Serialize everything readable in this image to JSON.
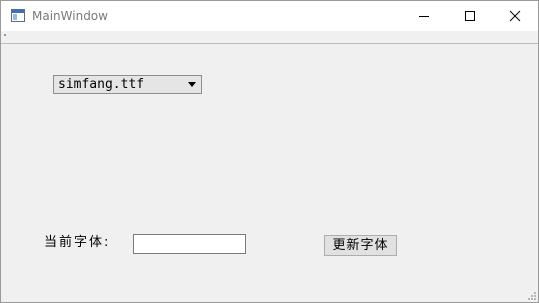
{
  "window": {
    "title": "MainWindow"
  },
  "font_combo": {
    "selected": "simfang.ttf"
  },
  "current_font": {
    "label": "当前字体:",
    "value": ""
  },
  "update_button": {
    "label": "更新字体"
  },
  "icons": {
    "app": "window-app-icon",
    "minimize": "minimize-icon",
    "maximize": "maximize-icon",
    "close": "close-icon",
    "dropdown": "chevron-down-icon",
    "resize": "size-grip-icon"
  },
  "colors": {
    "titlebar": "#ffffff",
    "client_bg": "#f0f0f0",
    "combo_bg": "#e5e5e5",
    "button_bg": "#e1e1e1"
  }
}
